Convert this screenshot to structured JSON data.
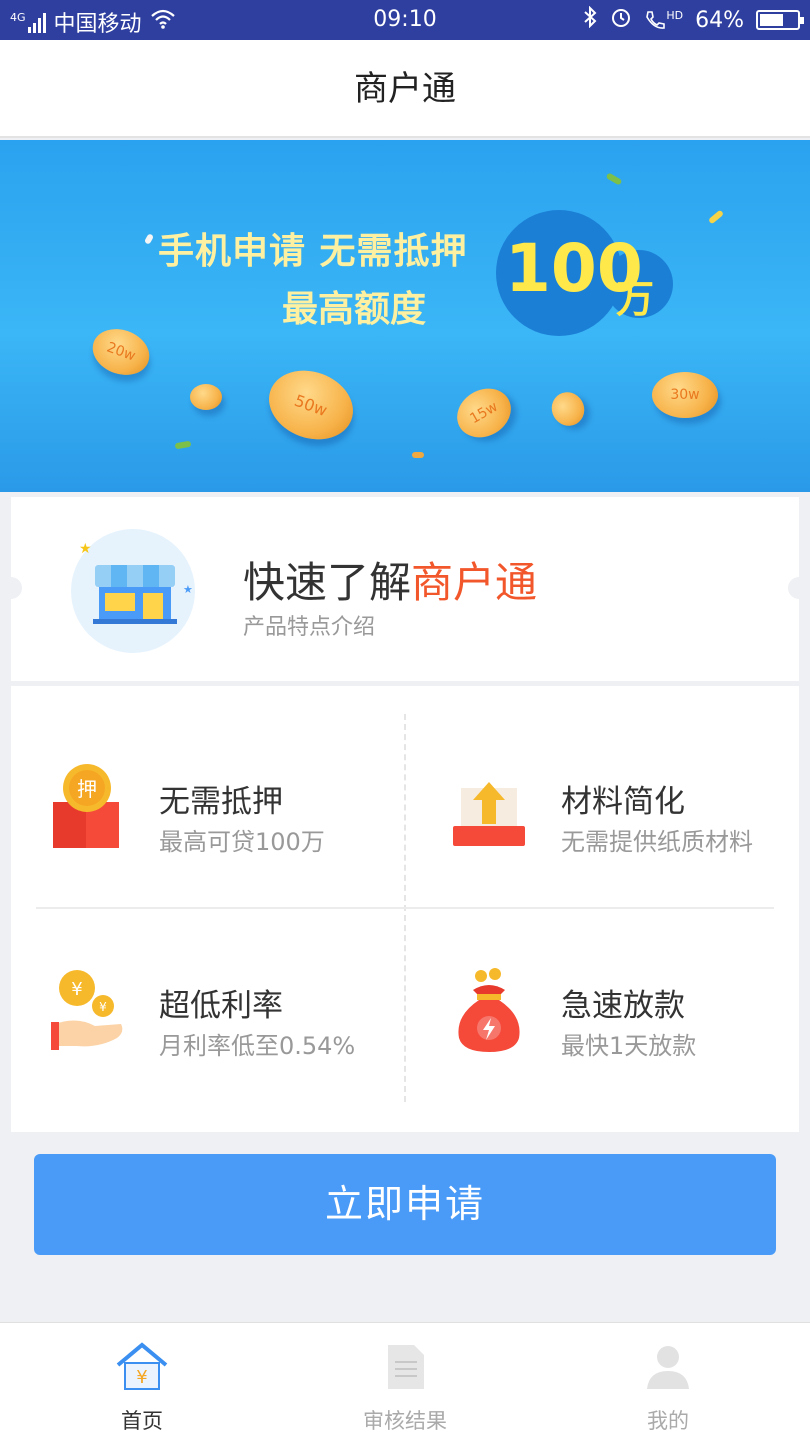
{
  "status_bar": {
    "network": "4G",
    "carrier": "中国移动",
    "time": "09:10",
    "call_badge": "HD",
    "battery_text": "64%",
    "battery_level": 0.64,
    "icons": [
      "signal-icon",
      "wifi-icon",
      "bluetooth-icon",
      "alarm-icon",
      "hd-call-icon",
      "battery-icon"
    ]
  },
  "header": {
    "title": "商户通"
  },
  "banner": {
    "line1": "手机申请  无需抵押",
    "line2": "最高额度",
    "amount": "100",
    "unit": "万",
    "coin_labels": [
      "20w",
      "50w",
      "15w",
      "30w"
    ]
  },
  "intro": {
    "title_prefix": "快速了解",
    "title_highlight": "商户通",
    "subtitle": "产品特点介绍",
    "icon": "store-icon"
  },
  "features": [
    {
      "title": "无需抵押",
      "desc": "最高可贷100万",
      "icon": "no-collateral-icon",
      "badge": "押"
    },
    {
      "title": "材料简化",
      "desc": "无需提供纸质材料",
      "icon": "upload-materials-icon"
    },
    {
      "title": "超低利率",
      "desc": "月利率低至0.54%",
      "icon": "low-rate-coins-icon"
    },
    {
      "title": "急速放款",
      "desc": "最快1天放款",
      "icon": "money-bag-icon"
    }
  ],
  "apply_button": {
    "label": "立即申请"
  },
  "tabbar": {
    "tabs": [
      {
        "label": "首页",
        "icon": "home-icon",
        "active": true
      },
      {
        "label": "审核结果",
        "icon": "document-icon",
        "active": false
      },
      {
        "label": "我的",
        "icon": "user-icon",
        "active": false
      }
    ]
  },
  "colors": {
    "status_bar": "#2f3f9f",
    "accent_blue": "#4a9bf7",
    "highlight_red": "#f2572b",
    "banner_yellow": "#ffe94a"
  }
}
